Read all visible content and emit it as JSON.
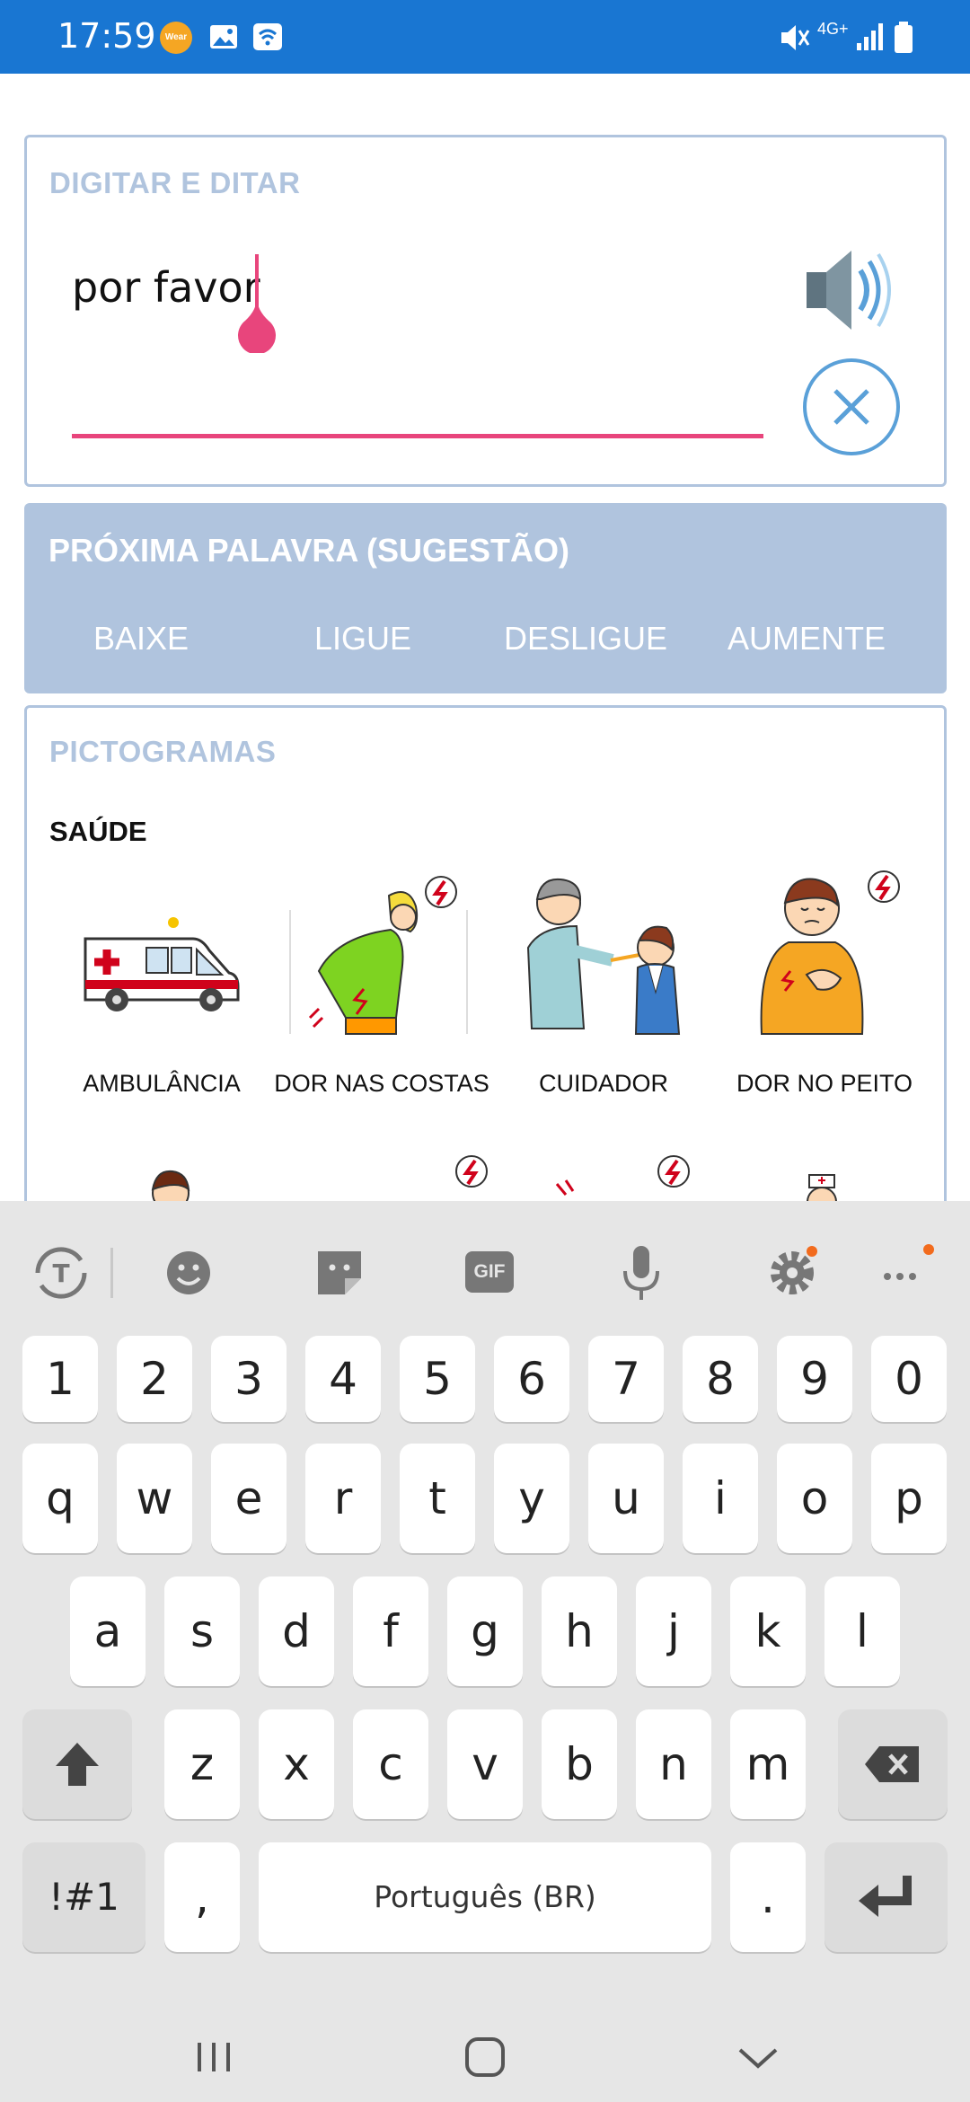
{
  "status_bar": {
    "time": "17:59",
    "wear_label": "Wear",
    "network": "4G+"
  },
  "input_card": {
    "title": "DIGITAR E DITAR",
    "typed_text": "por favor",
    "speaker_icon": "speaker-icon",
    "clear_icon": "close-icon"
  },
  "suggestion": {
    "title": "PRÓXIMA PALAVRA (SUGESTÃO)",
    "words": [
      "BAIXE",
      "LIGUE",
      "DESLIGUE",
      "AUMENTE"
    ]
  },
  "pictograms": {
    "title": "PICTOGRAMAS",
    "category": "SAÚDE",
    "items": [
      {
        "label": "AMBULÂNCIA",
        "icon": "ambulance-icon"
      },
      {
        "label": "DOR NAS COSTAS",
        "icon": "back-pain-icon"
      },
      {
        "label": "CUIDADOR",
        "icon": "caregiver-icon"
      },
      {
        "label": "DOR NO PEITO",
        "icon": "chest-pain-icon"
      }
    ]
  },
  "keyboard": {
    "tool_icons": [
      "translate-icon",
      "emoji-icon",
      "sticker-icon",
      "gif-icon",
      "microphone-icon",
      "settings-icon",
      "more-icon"
    ],
    "gif_label": "GIF",
    "row_numbers": [
      "1",
      "2",
      "3",
      "4",
      "5",
      "6",
      "7",
      "8",
      "9",
      "0"
    ],
    "row_1": [
      "q",
      "w",
      "e",
      "r",
      "t",
      "y",
      "u",
      "i",
      "o",
      "p"
    ],
    "row_2": [
      "a",
      "s",
      "d",
      "f",
      "g",
      "h",
      "j",
      "k",
      "l"
    ],
    "row_3": [
      "z",
      "x",
      "c",
      "v",
      "b",
      "n",
      "m"
    ],
    "symbols_label": "!#1",
    "comma_label": ",",
    "space_label": "Português (BR)",
    "period_label": "."
  },
  "colors": {
    "status_bar": "#1976d2",
    "card_border": "#b0c4de",
    "accent_pink": "#e8457c",
    "accent_blue": "#5aa0d8",
    "keyboard_bg": "#e6e6e6"
  }
}
